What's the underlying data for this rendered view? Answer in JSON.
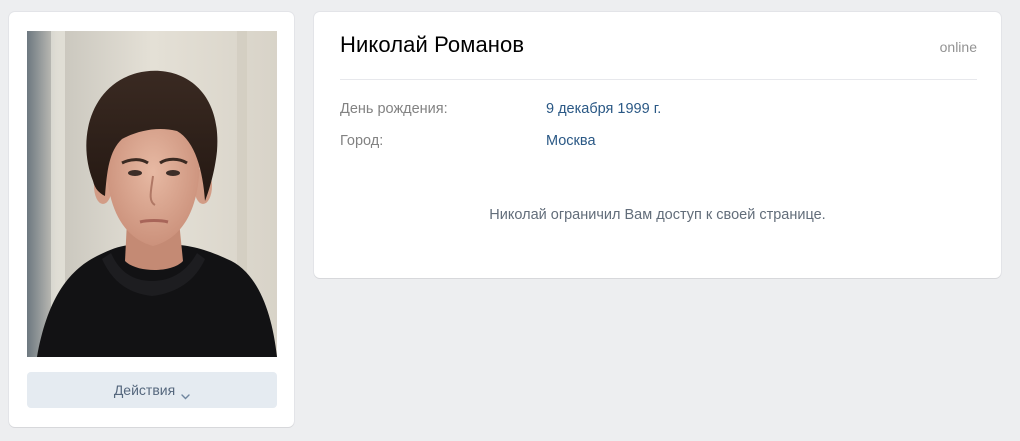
{
  "profile": {
    "name": "Николай Романов",
    "status": "online",
    "photo_icon": "profile-photo"
  },
  "info": [
    {
      "label": "День рождения:",
      "value": "9 декабря 1999 г."
    },
    {
      "label": "Город:",
      "value": "Москва"
    }
  ],
  "restriction_message": "Николай ограничил Вам доступ к своей странице.",
  "actions": {
    "label": "Действия",
    "icon": "chevron-down-icon"
  },
  "colors": {
    "background": "#edeef0",
    "card": "#ffffff",
    "link": "#2a5885",
    "label": "#828282",
    "button_bg": "#e5ebf1",
    "button_text": "#55677d"
  }
}
